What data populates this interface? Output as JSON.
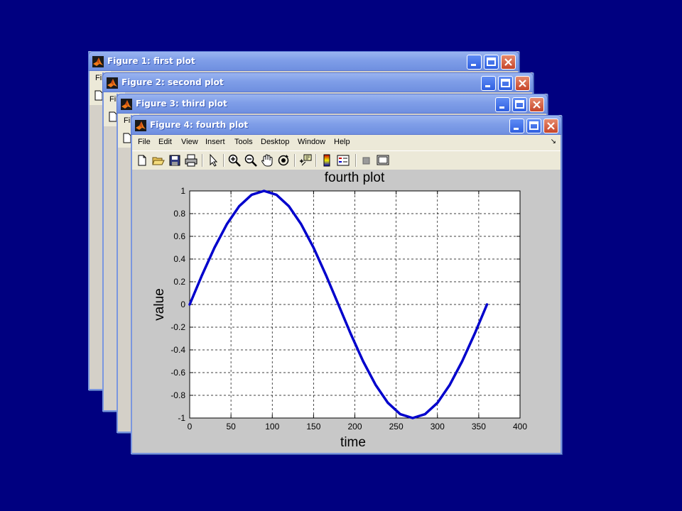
{
  "colors": {
    "desktop": "#000080",
    "series": "#0000cc",
    "window_bg": "#d4d0c8"
  },
  "windows": [
    {
      "title": "Figure 1: first plot",
      "menu_stub": "Fil"
    },
    {
      "title": "Figure 2: second plot",
      "menu_stub": "Fil"
    },
    {
      "title": "Figure 3: third plot",
      "menu_stub": "Fil"
    },
    {
      "title": "Figure 4: fourth plot",
      "menu": [
        "File",
        "Edit",
        "View",
        "Insert",
        "Tools",
        "Desktop",
        "Window",
        "Help"
      ],
      "menu_arrow": "↘",
      "toolbar_icons": [
        "new-file-icon",
        "open-folder-icon",
        "save-icon",
        "print-icon",
        "pointer-icon",
        "zoom-in-icon",
        "zoom-out-icon",
        "pan-hand-icon",
        "rotate-3d-icon",
        "data-cursor-icon",
        "colorbar-icon",
        "legend-icon",
        "hide-plot-tools-icon",
        "show-plot-tools-icon"
      ]
    }
  ],
  "chart_data": {
    "type": "line",
    "title": "fourth plot",
    "xlabel": "time",
    "ylabel": "value",
    "xlim": [
      0,
      400
    ],
    "ylim": [
      -1,
      1
    ],
    "xticks": [
      0,
      50,
      100,
      150,
      200,
      250,
      300,
      350,
      400
    ],
    "yticks": [
      -1,
      -0.8,
      -0.6,
      -0.4,
      -0.2,
      0,
      0.2,
      0.4,
      0.6,
      0.8,
      1
    ],
    "ytick_labels": [
      "-1",
      "-0.8",
      "-0.6",
      "-0.4",
      "-0.2",
      "0",
      "0.2",
      "0.4",
      "0.6",
      "0.8",
      "1"
    ],
    "grid": true,
    "series": [
      {
        "x": [
          0,
          15,
          30,
          45,
          60,
          75,
          90,
          105,
          120,
          135,
          150,
          165,
          180,
          195,
          210,
          225,
          240,
          255,
          270,
          285,
          300,
          315,
          330,
          345,
          360
        ],
        "y": [
          0,
          0.259,
          0.5,
          0.707,
          0.866,
          0.966,
          1,
          0.966,
          0.866,
          0.707,
          0.5,
          0.259,
          0,
          -0.259,
          -0.5,
          -0.707,
          -0.866,
          -0.966,
          -1,
          -0.966,
          -0.866,
          -0.707,
          -0.5,
          -0.259,
          0
        ]
      }
    ]
  }
}
